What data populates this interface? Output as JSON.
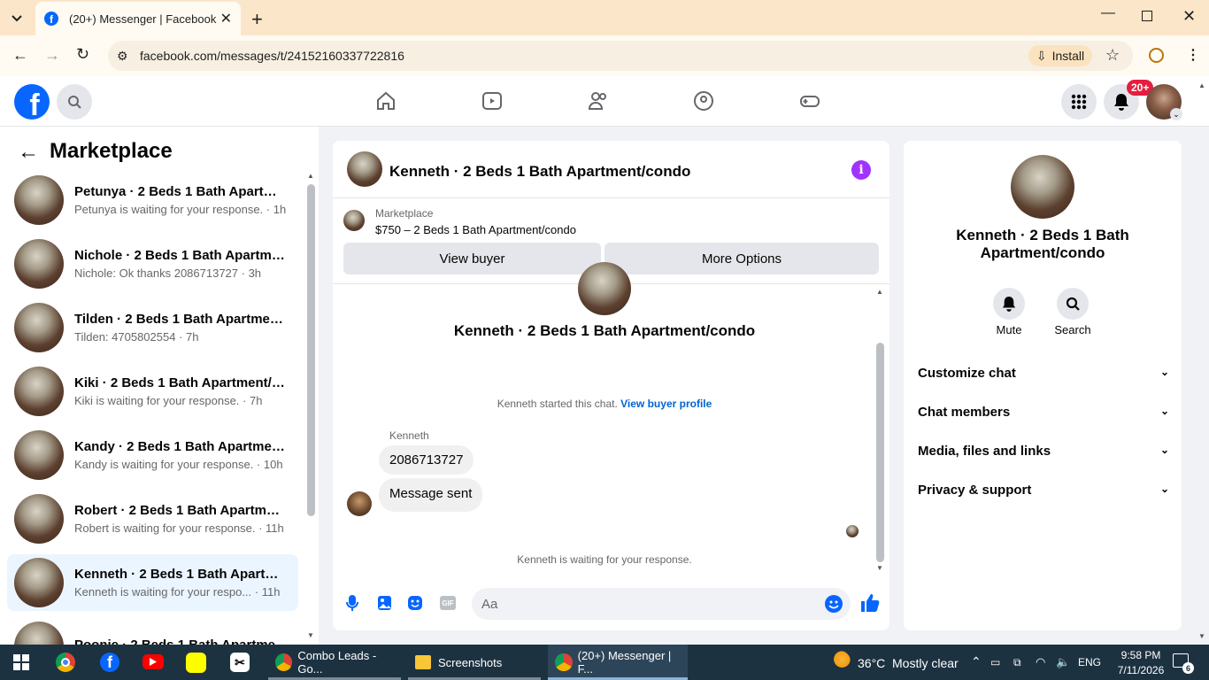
{
  "browser": {
    "tab_title": "(20+) Messenger | Facebook",
    "url": "facebook.com/messages/t/24152160337722816",
    "install_label": "Install"
  },
  "header": {
    "notif_badge": "20+"
  },
  "left": {
    "title": "Marketplace",
    "conversations": [
      {
        "name": "Petunya · 2 Beds 1 Bath Apartme...",
        "snippet": "Petunya is waiting for your response. · 1h"
      },
      {
        "name": "Nichole · 2 Beds 1 Bath Apartme...",
        "snippet": "Nichole: Ok thanks 2086713727 · 3h"
      },
      {
        "name": "Tilden · 2 Beds 1 Bath Apartmen...",
        "snippet": "Tilden: 4705802554 · 7h"
      },
      {
        "name": "Kiki · 2 Beds 1 Bath Apartment/c...",
        "snippet": "Kiki is waiting for your response. · 7h"
      },
      {
        "name": "Kandy · 2 Beds 1 Bath Apartmen...",
        "snippet": "Kandy is waiting for your response. · 10h"
      },
      {
        "name": "Robert · 2 Beds 1 Bath Apartmen...",
        "snippet": "Robert is waiting for your response. · 11h"
      },
      {
        "name": "Kenneth · 2 Beds 1 Bath Apartm...",
        "snippet": "Kenneth is waiting for your respo...  · 11h"
      },
      {
        "name": "Poonie · 2 Beds 1 Bath Apartme...",
        "snippet": ""
      }
    ]
  },
  "chat": {
    "title": "Kenneth · 2 Beds 1 Bath Apartment/condo",
    "listing_source": "Marketplace",
    "listing": "$750 – 2 Beds 1 Bath Apartment/condo",
    "view_buyer": "View buyer",
    "more_options": "More Options",
    "profile_name": "Kenneth · 2 Beds 1 Bath Apartment/condo",
    "started": "Kenneth started this chat.",
    "view_profile": "View buyer profile",
    "sender": "Kenneth",
    "msg1": "2086713727",
    "msg2": "Message sent",
    "waiting": "Kenneth is waiting for your response.",
    "composer_placeholder": "Aa"
  },
  "right": {
    "name": "Kenneth · 2 Beds 1 Bath Apartment/condo",
    "mute": "Mute",
    "search": "Search",
    "rows": [
      "Customize chat",
      "Chat members",
      "Media, files and links",
      "Privacy & support"
    ]
  },
  "taskbar": {
    "app1": "Combo Leads - Go...",
    "app2": "Screenshots",
    "app3": "(20+) Messenger | F...",
    "temp": "36°C",
    "weather": "Mostly clear",
    "lang": "ENG",
    "time": "9:58 PM",
    "date": "7/11/2026",
    "notif": "6"
  },
  "colors": {
    "fb_blue": "#0866ff",
    "purple": "#a033ff",
    "badge_red": "#e41e3f"
  }
}
